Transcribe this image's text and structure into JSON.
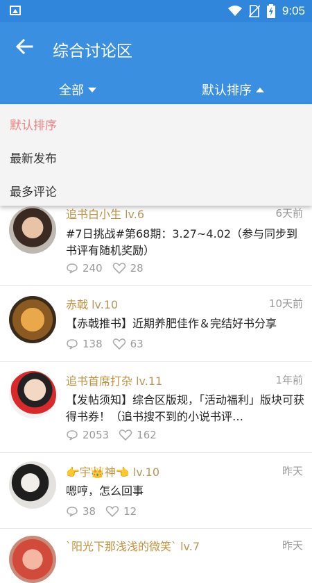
{
  "status_bar": {
    "time": "9:05"
  },
  "header": {
    "title": "综合讨论区",
    "filter_category": "全部",
    "filter_sort": "默认排序"
  },
  "sort_menu": {
    "items": [
      {
        "label": "默认排序",
        "active": true
      },
      {
        "label": "最新发布",
        "active": false
      },
      {
        "label": "最多评论",
        "active": false
      }
    ]
  },
  "posts": [
    {
      "author": "追书白小生",
      "level": "lv.6",
      "time": "6天前",
      "title": "#7日挑战#第68期：3.27~4.02（参与同步到书评有随机奖励）",
      "comments": "240",
      "likes": "28"
    },
    {
      "author": "赤戟",
      "level": "lv.10",
      "time": "10天前",
      "title": "【赤戟推书】近期养肥佳作＆完结好书分享",
      "comments": "138",
      "likes": "63"
    },
    {
      "author": "追书首席打杂",
      "level": "lv.11",
      "time": "1年前",
      "title": "【发帖须知】综合区版规，「活动福利」版块可获得书券！（追书搜不到的小说书评…",
      "comments": "2053",
      "likes": "162"
    },
    {
      "author": "👉宇👑神👈",
      "level": "lv.10",
      "time": "昨天",
      "title": "嗯哼，怎么回事",
      "comments": "38",
      "likes": "12"
    },
    {
      "author": "`阳光下那浅浅的微笑`",
      "level": "lv.7",
      "time": "昨天",
      "title": "",
      "comments": "",
      "likes": ""
    }
  ],
  "colors": {
    "primary": "#3a8fe0",
    "active_menu": "#f08383",
    "author": "#c0913f"
  }
}
